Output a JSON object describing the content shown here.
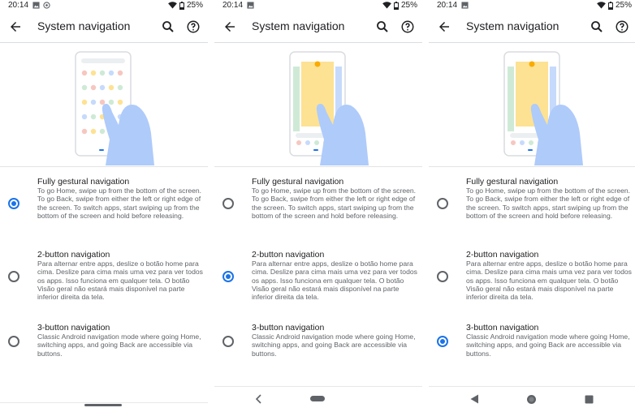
{
  "status": {
    "time": "20:14",
    "battery": "25%"
  },
  "appbar": {
    "title": "System navigation"
  },
  "options": [
    {
      "title": "Fully gestural navigation",
      "desc": "To go Home, swipe up from the bottom of the screen. To go Back, swipe from either the left or right edge of the screen. To switch apps, start swiping up from the bottom of the screen and hold before releasing."
    },
    {
      "title": "2-button navigation",
      "desc": "Para alternar entre apps, deslize o botão home para cima. Deslize para cima mais uma vez para ver todos os apps. Isso funciona em qualquer tela. O botão Visão geral não estará mais disponível na parte inferior direita da tela."
    },
    {
      "title": "3-button navigation",
      "desc": "Classic Android navigation mode where going Home, switching apps, and going Back are accessible via buttons."
    }
  ],
  "panels": [
    {
      "selected": 0,
      "navbar": "gesture",
      "illustration": "app-grid"
    },
    {
      "selected": 1,
      "navbar": "two-button",
      "illustration": "app-cards"
    },
    {
      "selected": 2,
      "navbar": "three-button",
      "illustration": "app-cards"
    }
  ],
  "colors": {
    "accent": "#1a73e8",
    "hand": "#aecbfa",
    "card_yellow": "#fde293",
    "card_green": "#ceead6"
  }
}
